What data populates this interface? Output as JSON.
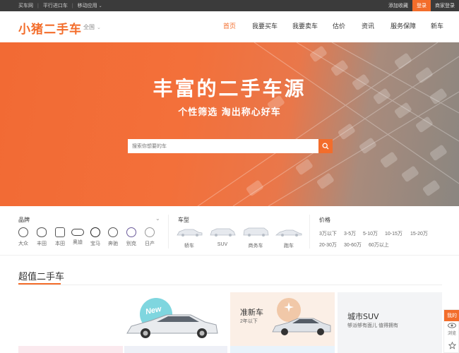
{
  "topbar": {
    "links": [
      "买车网",
      "平行进口车",
      "移动应用"
    ],
    "add_favorite": "添加收藏",
    "login": "登录",
    "register": "商家登录"
  },
  "header": {
    "logo": "小猪二手车",
    "city": "全国",
    "nav": [
      "首页",
      "我要买车",
      "我要卖车",
      "估价",
      "资讯",
      "服务保障",
      "新车"
    ],
    "active_nav": "首页"
  },
  "hero": {
    "title": "丰富的二手车源",
    "subtitle": "个性筛选  淘出称心好车",
    "search_placeholder": "搜索你想要的车"
  },
  "filters": {
    "brand_title": "品牌",
    "brands": [
      "大众",
      "丰田",
      "本田",
      "奥迪",
      "宝马",
      "奔驰",
      "别克",
      "日产"
    ],
    "type_title": "车型",
    "types": [
      "轿车",
      "SUV",
      "商务车",
      "跑车"
    ],
    "price_title": "价格",
    "prices_row1": [
      "3万以下",
      "3-5万",
      "5-10万",
      "10-15万",
      "15-20万"
    ],
    "prices_row2": [
      "20-30万",
      "30-60万",
      "60万以上"
    ]
  },
  "section": {
    "title": "超值二手车",
    "cards": [
      {
        "title": "",
        "sub": "",
        "badge": "New"
      },
      {
        "title": "准新车",
        "sub": "2年以下"
      },
      {
        "title": "城市SUV",
        "sub": "够派够有面儿 值得拥有"
      }
    ]
  },
  "side": {
    "buy": "我的",
    "browse": "浏览",
    "collect_icon": "star-icon"
  },
  "colors": {
    "accent": "#f36d2b",
    "topbar": "#3b3b3b"
  }
}
